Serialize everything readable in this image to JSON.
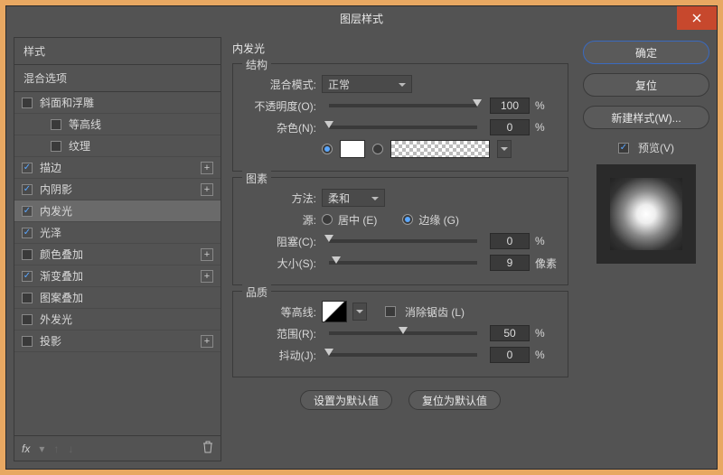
{
  "window": {
    "title": "图层样式"
  },
  "close_icon": "×",
  "left": {
    "header": "样式",
    "subheader": "混合选项",
    "items": [
      {
        "label": "斜面和浮雕",
        "checked": false,
        "hasPlus": false,
        "child": false
      },
      {
        "label": "等高线",
        "checked": false,
        "hasPlus": false,
        "child": true
      },
      {
        "label": "纹理",
        "checked": false,
        "hasPlus": false,
        "child": true
      },
      {
        "label": "描边",
        "checked": true,
        "hasPlus": true,
        "child": false
      },
      {
        "label": "内阴影",
        "checked": true,
        "hasPlus": true,
        "child": false
      },
      {
        "label": "内发光",
        "checked": true,
        "hasPlus": false,
        "child": false,
        "selected": true
      },
      {
        "label": "光泽",
        "checked": true,
        "hasPlus": false,
        "child": false
      },
      {
        "label": "颜色叠加",
        "checked": false,
        "hasPlus": true,
        "child": false
      },
      {
        "label": "渐变叠加",
        "checked": true,
        "hasPlus": true,
        "child": false
      },
      {
        "label": "图案叠加",
        "checked": false,
        "hasPlus": false,
        "child": false
      },
      {
        "label": "外发光",
        "checked": false,
        "hasPlus": false,
        "child": false
      },
      {
        "label": "投影",
        "checked": false,
        "hasPlus": true,
        "child": false
      }
    ],
    "fx": "fx"
  },
  "center": {
    "title": "内发光",
    "structure": {
      "group": "结构",
      "blend_label": "混合模式:",
      "blend_value": "正常",
      "opacity_label": "不透明度(O):",
      "opacity_value": "100",
      "percent": "%",
      "noise_label": "杂色(N):",
      "noise_value": "0"
    },
    "elements": {
      "group": "图素",
      "technique_label": "方法:",
      "technique_value": "柔和",
      "source_label": "源:",
      "center_radio": "居中 (E)",
      "edge_radio": "边缘 (G)",
      "choke_label": "阻塞(C):",
      "choke_value": "0",
      "size_label": "大小(S):",
      "size_value": "9",
      "px": "像素"
    },
    "quality": {
      "group": "品质",
      "contour_label": "等高线:",
      "antialias": "消除锯齿 (L)",
      "range_label": "范围(R):",
      "range_value": "50",
      "jitter_label": "抖动(J):",
      "jitter_value": "0"
    },
    "buttons": {
      "default": "设置为默认值",
      "reset": "复位为默认值"
    }
  },
  "right": {
    "ok": "确定",
    "cancel": "复位",
    "newstyle": "新建样式(W)...",
    "preview": "预览(V)"
  }
}
